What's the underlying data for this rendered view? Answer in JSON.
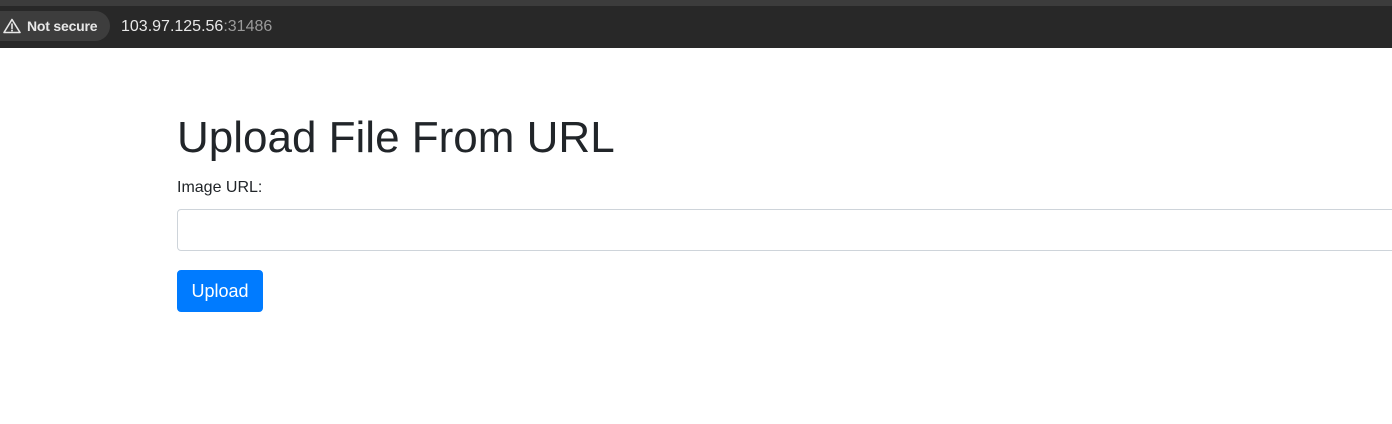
{
  "browser": {
    "security_label": "Not secure",
    "security_icon": "warning-triangle-icon",
    "url_host": "103.97.125.56",
    "url_port": ":31486"
  },
  "page": {
    "title": "Upload File From URL",
    "field_label": "Image URL:",
    "input_value": "",
    "input_placeholder": "",
    "upload_label": "Upload"
  },
  "colors": {
    "primary_button": "#007bff",
    "browser_bar": "#282828",
    "text": "#212529"
  }
}
